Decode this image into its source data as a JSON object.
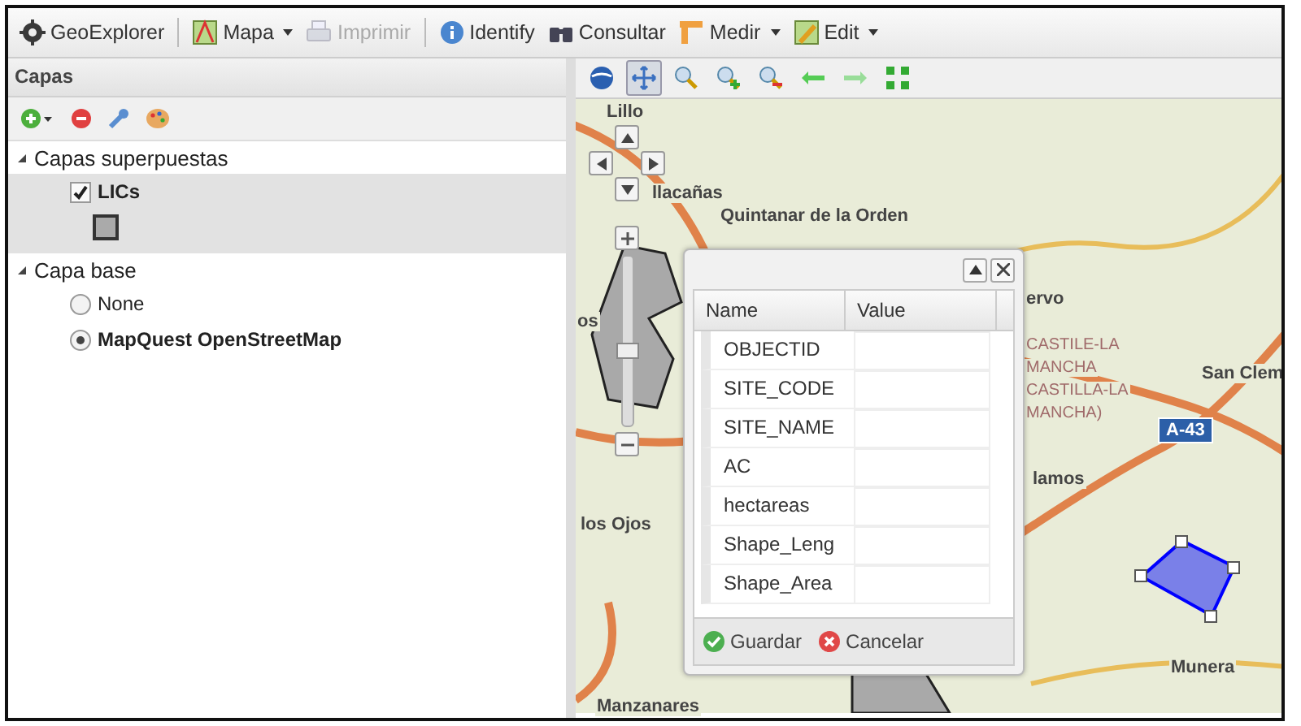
{
  "toolbar": [
    {
      "kind": "app",
      "label": "GeoExplorer",
      "disabled": false,
      "caret": false
    },
    {
      "kind": "sep"
    },
    {
      "kind": "map",
      "label": "Mapa",
      "disabled": false,
      "caret": true
    },
    {
      "kind": "print",
      "label": "Imprimir",
      "disabled": true,
      "caret": false
    },
    {
      "kind": "sep"
    },
    {
      "kind": "info",
      "label": "Identify",
      "disabled": false,
      "caret": false
    },
    {
      "kind": "query",
      "label": "Consultar",
      "disabled": false,
      "caret": false
    },
    {
      "kind": "measure",
      "label": "Medir",
      "disabled": false,
      "caret": true
    },
    {
      "kind": "edit",
      "label": "Edit",
      "disabled": false,
      "caret": true
    }
  ],
  "layers_panel": {
    "title": "Capas",
    "groups": [
      {
        "label": "Capas superpuestas",
        "expanded": true,
        "children": [
          {
            "kind": "check",
            "label": "LICs",
            "checked": true,
            "selected": true,
            "legend": true
          }
        ]
      },
      {
        "label": "Capa base",
        "expanded": true,
        "children": [
          {
            "kind": "radio",
            "label": "None",
            "checked": false,
            "selected": false,
            "legend": false
          },
          {
            "kind": "radio",
            "label": "MapQuest OpenStreetMap",
            "checked": true,
            "selected": false,
            "legend": false
          }
        ]
      }
    ]
  },
  "map_tools": [
    {
      "kind": "globe",
      "selected": false
    },
    {
      "kind": "pan",
      "selected": true
    },
    {
      "kind": "zoom",
      "selected": false
    },
    {
      "kind": "zoomin",
      "selected": false
    },
    {
      "kind": "zoomout",
      "selected": false
    },
    {
      "kind": "back",
      "selected": false
    },
    {
      "kind": "forward",
      "selected": false
    },
    {
      "kind": "extent",
      "selected": false
    }
  ],
  "zoom_slider": {
    "level": 0.45
  },
  "map_labels": [
    {
      "kind": "town",
      "text": "Lillo"
    },
    {
      "kind": "town",
      "text": "llacañas"
    },
    {
      "kind": "town",
      "text": "Quintanar de la Orden"
    },
    {
      "kind": "town",
      "text": "os"
    },
    {
      "kind": "town",
      "text": "ervo"
    },
    {
      "kind": "region",
      "text": "CASTILE-LA"
    },
    {
      "kind": "region",
      "text": "MANCHA"
    },
    {
      "kind": "region",
      "text": "CASTILLA-LA"
    },
    {
      "kind": "region",
      "text": "MANCHA)"
    },
    {
      "kind": "town",
      "text": "San Clem"
    },
    {
      "kind": "road",
      "text": "A-43"
    },
    {
      "kind": "town",
      "text": "lamos"
    },
    {
      "kind": "town",
      "text": "los Ojos"
    },
    {
      "kind": "town",
      "text": "Munera"
    },
    {
      "kind": "town",
      "text": "Manzanares"
    }
  ],
  "attribute_popup": {
    "columns": [
      "Name",
      "Value"
    ],
    "rows": [
      {
        "name": "OBJECTID"
      },
      {
        "name": "SITE_CODE"
      },
      {
        "name": "SITE_NAME"
      },
      {
        "name": "AC"
      },
      {
        "name": "hectareas"
      },
      {
        "name": "Shape_Leng"
      },
      {
        "name": "Shape_Area"
      }
    ],
    "buttons": [
      {
        "kind": "save",
        "label": "Guardar"
      },
      {
        "kind": "cancel",
        "label": "Cancelar"
      }
    ]
  }
}
